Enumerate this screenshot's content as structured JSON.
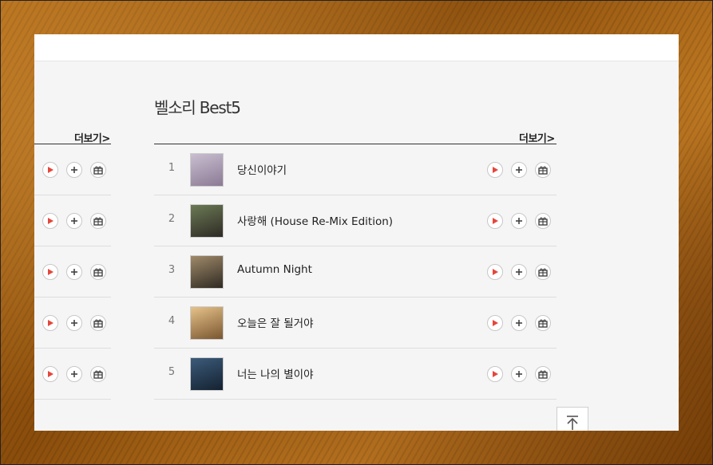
{
  "section": {
    "title": "벨소리 Best5",
    "more_label": "더보기>"
  },
  "left_column": {
    "more_label": "더보기>",
    "row_count": 5
  },
  "songs": [
    {
      "rank": "1",
      "title": "당신이야기",
      "thumb_colors": [
        "#c9bfd0",
        "#8b7a95"
      ]
    },
    {
      "rank": "2",
      "title": "사랑해 (House Re-Mix Edition)",
      "thumb_colors": [
        "#6b7a55",
        "#2e2a24"
      ]
    },
    {
      "rank": "3",
      "title": "Autumn Night",
      "thumb_colors": [
        "#a08a6a",
        "#2f2a22"
      ]
    },
    {
      "rank": "4",
      "title": "오늘은 잘 될거야",
      "thumb_colors": [
        "#e6c28a",
        "#7a5630"
      ]
    },
    {
      "rank": "5",
      "title": "너는 나의 별이야",
      "thumb_colors": [
        "#3c5b7a",
        "#142231"
      ]
    }
  ],
  "icons": {
    "play": "play-icon",
    "add": "plus-icon",
    "gift": "gift-icon",
    "top": "scroll-top-icon"
  },
  "colors": {
    "play": "#e5473b",
    "text": "#222222",
    "rule": "#333333"
  }
}
